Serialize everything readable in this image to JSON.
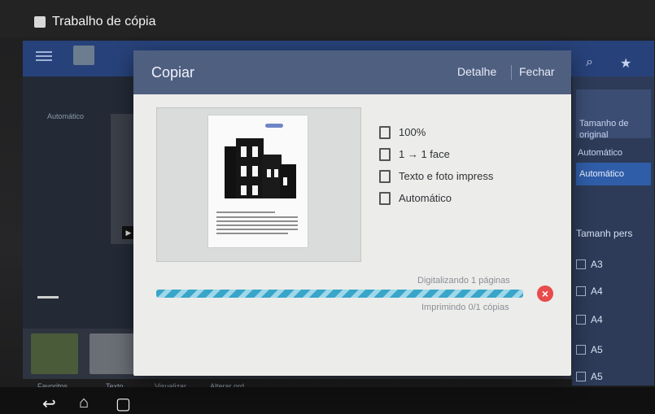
{
  "app": {
    "title": "Trabalho de cópia"
  },
  "background": {
    "left_label": "Automático",
    "right_header_line1": "Tamanho de",
    "right_header_line2": "original",
    "right_subheading": "Automático",
    "right_selected": "Automático",
    "right_section": "Tamanh pers",
    "sizes": [
      "A3",
      "A4",
      "A4",
      "A5",
      "A5"
    ],
    "captions": [
      "Favoritos",
      "Texto",
      "Visualizar",
      "Alterar ord."
    ]
  },
  "dialog": {
    "title": "Copiar",
    "detail_label": "Detalhe",
    "close_label": "Fechar",
    "settings": [
      {
        "icon": "zoom-icon",
        "label": "100%"
      },
      {
        "icon": "duplex-icon",
        "label": "1 → 1 face"
      },
      {
        "icon": "document-type-icon",
        "label": "Texto e foto impress"
      },
      {
        "icon": "paper-icon",
        "label": "Automático"
      }
    ],
    "scan_status": "Digitalizando 1 páginas",
    "print_status": "Imprimindo 0/1 cópias"
  },
  "colors": {
    "accent": "#4f5f80",
    "progress": "#39a5c9",
    "cancel": "#e74b4b"
  }
}
